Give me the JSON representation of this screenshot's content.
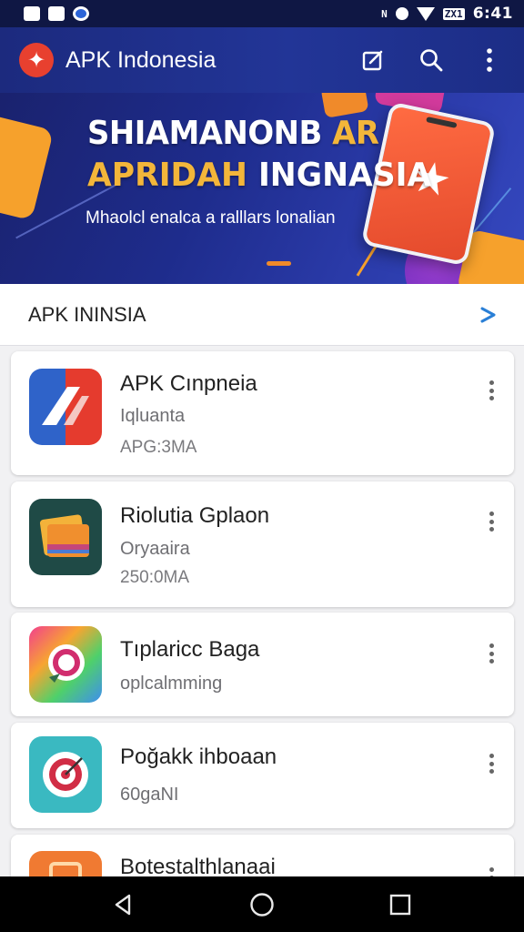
{
  "status_bar": {
    "time": "6:41",
    "left_icons": [
      "notification-icon",
      "image-icon",
      "vpn-icon"
    ],
    "right_icons": [
      "nfc-icon",
      "shield-icon",
      "wifi-icon",
      "battery-icon"
    ],
    "battery_text": "ZX1"
  },
  "app_bar": {
    "title": "APK Indonesia",
    "colors": {
      "background": "#1f2f8c",
      "logo": "#e8402f"
    }
  },
  "banner": {
    "line1_white": "SHIAMANONB ",
    "line1_accent": "AR",
    "line2_accent": "APRIDAH ",
    "line2_white": "INGNASIA",
    "subtitle": "Mhaolcl enalca a ralllars lonalian",
    "colors": {
      "accent": "#f3b63a",
      "orange": "#f6a12c"
    }
  },
  "section": {
    "title": "APK ININSIA"
  },
  "apps": [
    {
      "name": "APK Cınpneia",
      "subtitle": "Iqluanta",
      "size": "APG:3MA"
    },
    {
      "name": "Riolutia Gplaon",
      "subtitle": "Oryaaira",
      "size": "250:0MA"
    },
    {
      "name": "Tıplaricc Baga",
      "subtitle": "oplcalmming",
      "size": ""
    },
    {
      "name": "Poğakk ihboaan",
      "subtitle": "60gaNI",
      "size": ""
    },
    {
      "name": "Botestalthlanaai",
      "subtitle": "",
      "size": ""
    }
  ],
  "nav": {
    "buttons": [
      "back-icon",
      "home-icon",
      "recents-icon"
    ]
  }
}
